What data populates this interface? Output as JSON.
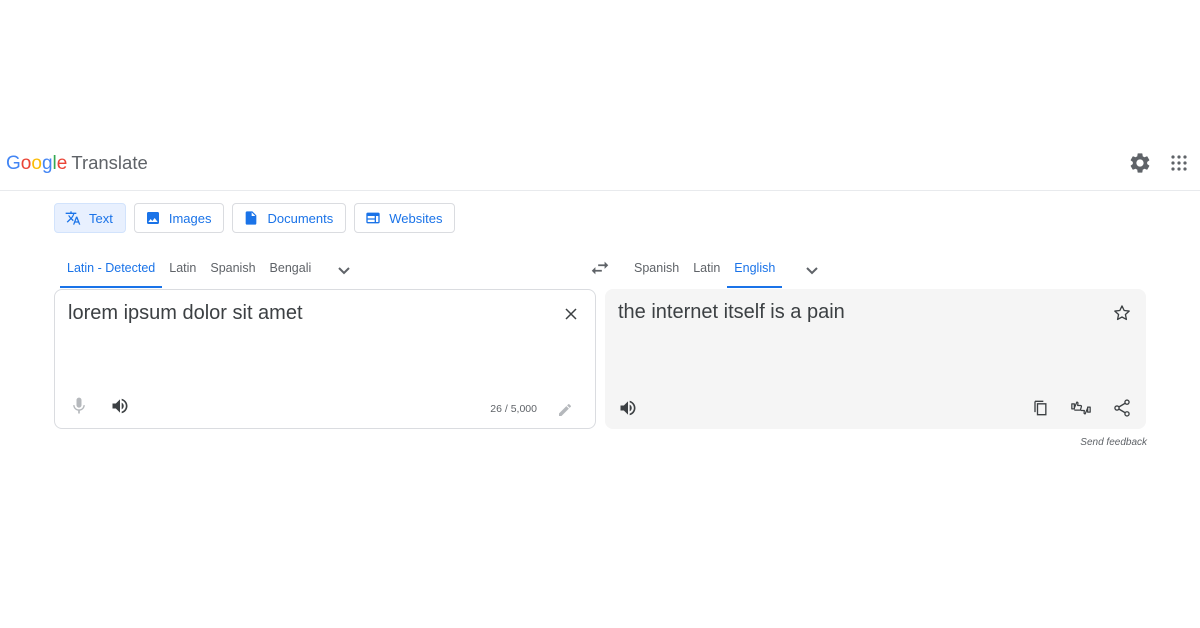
{
  "header": {
    "logo": {
      "letters": [
        "G",
        "o",
        "o",
        "g",
        "l",
        "e"
      ],
      "product": "Translate"
    },
    "icons": [
      "gear-icon",
      "apps-grid-icon"
    ]
  },
  "modes": [
    {
      "label": "Text",
      "icon": "translate-icon",
      "active": true
    },
    {
      "label": "Images",
      "icon": "image-icon",
      "active": false
    },
    {
      "label": "Documents",
      "icon": "document-icon",
      "active": false
    },
    {
      "label": "Websites",
      "icon": "website-icon",
      "active": false
    }
  ],
  "source_languages": {
    "tabs": [
      "Latin - Detected",
      "Latin",
      "Spanish",
      "Bengali"
    ],
    "selected": "Latin - Detected"
  },
  "target_languages": {
    "tabs": [
      "Spanish",
      "Latin",
      "English"
    ],
    "selected": "English"
  },
  "source": {
    "text": "lorem ipsum dolor sit amet",
    "char_count": "26 / 5,000"
  },
  "target": {
    "text": "the internet itself is a pain"
  },
  "feedback_label": "Send feedback",
  "colors": {
    "accent": "#1a73e8",
    "text": "#3c4043",
    "muted": "#5f6368",
    "target_bg": "#f5f5f5"
  }
}
